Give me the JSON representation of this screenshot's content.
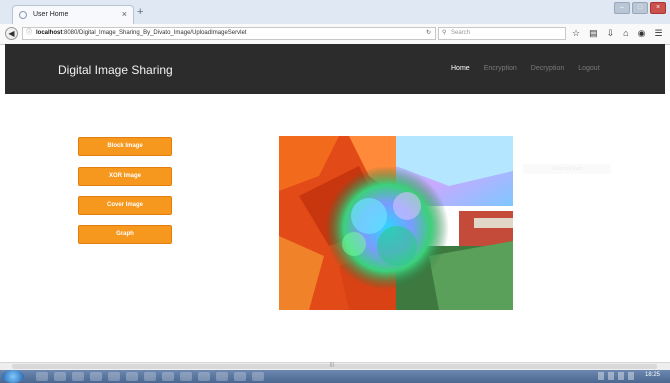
{
  "browser": {
    "tab_title": "User Home",
    "tab_close": "×",
    "new_tab": "+",
    "url_host": "localhost",
    "url_rest": ":8080/Digital_Image_Sharing_By_Divato_Image/UploadImageServlet",
    "search_placeholder": "Search",
    "window_controls": [
      "–",
      "□",
      "×"
    ],
    "toolbar_icons": [
      "star-icon",
      "reading-list-icon",
      "download-icon",
      "home-icon",
      "pocket-icon",
      "menu-icon"
    ]
  },
  "site": {
    "brand": "Digital Image Sharing",
    "menu": [
      "Home",
      "Encryption",
      "Decryption",
      "Logout"
    ]
  },
  "actions": {
    "buttons": [
      "Block Image",
      "XOR Image",
      "Cover Image",
      "Graph"
    ]
  },
  "output": {
    "faint_label": "Selected Part"
  },
  "taskbar": {
    "clock": "18:25"
  },
  "colors": {
    "header_bg": "#2c2c2c",
    "button_bg": "#f6971e",
    "button_text": "#ffffff"
  }
}
